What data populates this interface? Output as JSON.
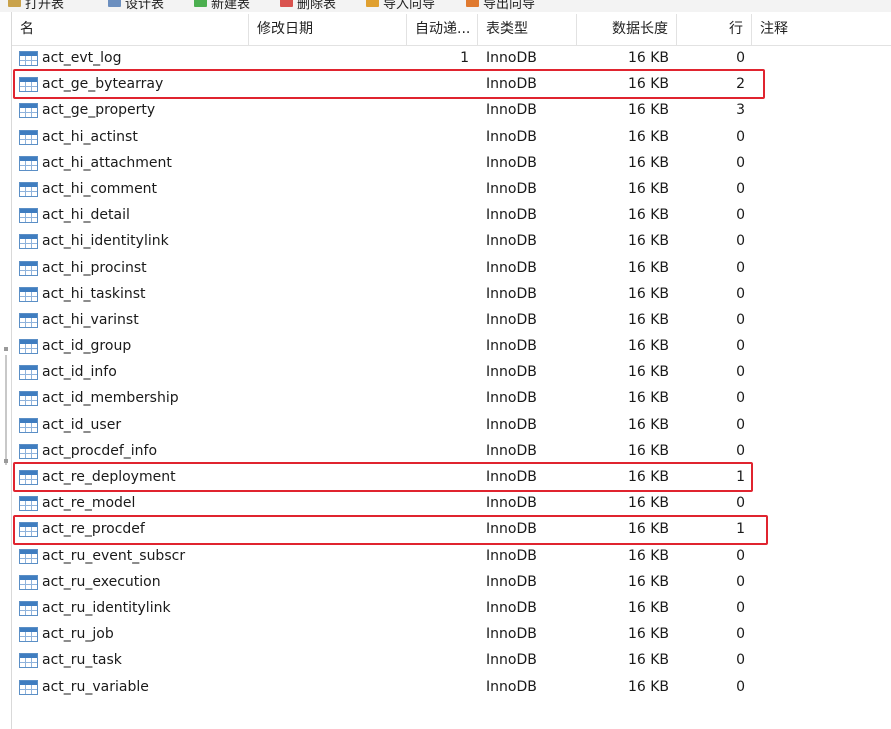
{
  "toolbar": {
    "items": [
      {
        "label": "打开表",
        "icon": "open-table-icon",
        "color": "#c9a24b"
      },
      {
        "label": "设计表",
        "icon": "design-table-icon",
        "color": "#6c8fbf"
      },
      {
        "label": "新建表",
        "icon": "new-table-icon",
        "color": "#4caf50"
      },
      {
        "label": "删除表",
        "icon": "delete-table-icon",
        "color": "#d9534f"
      },
      {
        "label": "导入向导",
        "icon": "import-wizard-icon",
        "color": "#e0a030"
      },
      {
        "label": "导出向导",
        "icon": "export-wizard-icon",
        "color": "#e07a30"
      }
    ]
  },
  "table": {
    "columns": [
      "名",
      "修改日期",
      "自动递...",
      "表类型",
      "数据长度",
      "行",
      "注释"
    ],
    "rows": [
      {
        "name": "act_evt_log",
        "modified": "",
        "auto_inc": "1",
        "engine": "InnoDB",
        "data_length": "16 KB",
        "rows": "0",
        "comment": "",
        "highlighted": false
      },
      {
        "name": "act_ge_bytearray",
        "modified": "",
        "auto_inc": "",
        "engine": "InnoDB",
        "data_length": "16 KB",
        "rows": "2",
        "comment": "",
        "highlighted": true
      },
      {
        "name": "act_ge_property",
        "modified": "",
        "auto_inc": "",
        "engine": "InnoDB",
        "data_length": "16 KB",
        "rows": "3",
        "comment": "",
        "highlighted": false
      },
      {
        "name": "act_hi_actinst",
        "modified": "",
        "auto_inc": "",
        "engine": "InnoDB",
        "data_length": "16 KB",
        "rows": "0",
        "comment": "",
        "highlighted": false
      },
      {
        "name": "act_hi_attachment",
        "modified": "",
        "auto_inc": "",
        "engine": "InnoDB",
        "data_length": "16 KB",
        "rows": "0",
        "comment": "",
        "highlighted": false
      },
      {
        "name": "act_hi_comment",
        "modified": "",
        "auto_inc": "",
        "engine": "InnoDB",
        "data_length": "16 KB",
        "rows": "0",
        "comment": "",
        "highlighted": false
      },
      {
        "name": "act_hi_detail",
        "modified": "",
        "auto_inc": "",
        "engine": "InnoDB",
        "data_length": "16 KB",
        "rows": "0",
        "comment": "",
        "highlighted": false
      },
      {
        "name": "act_hi_identitylink",
        "modified": "",
        "auto_inc": "",
        "engine": "InnoDB",
        "data_length": "16 KB",
        "rows": "0",
        "comment": "",
        "highlighted": false
      },
      {
        "name": "act_hi_procinst",
        "modified": "",
        "auto_inc": "",
        "engine": "InnoDB",
        "data_length": "16 KB",
        "rows": "0",
        "comment": "",
        "highlighted": false
      },
      {
        "name": "act_hi_taskinst",
        "modified": "",
        "auto_inc": "",
        "engine": "InnoDB",
        "data_length": "16 KB",
        "rows": "0",
        "comment": "",
        "highlighted": false
      },
      {
        "name": "act_hi_varinst",
        "modified": "",
        "auto_inc": "",
        "engine": "InnoDB",
        "data_length": "16 KB",
        "rows": "0",
        "comment": "",
        "highlighted": false
      },
      {
        "name": "act_id_group",
        "modified": "",
        "auto_inc": "",
        "engine": "InnoDB",
        "data_length": "16 KB",
        "rows": "0",
        "comment": "",
        "highlighted": false
      },
      {
        "name": "act_id_info",
        "modified": "",
        "auto_inc": "",
        "engine": "InnoDB",
        "data_length": "16 KB",
        "rows": "0",
        "comment": "",
        "highlighted": false
      },
      {
        "name": "act_id_membership",
        "modified": "",
        "auto_inc": "",
        "engine": "InnoDB",
        "data_length": "16 KB",
        "rows": "0",
        "comment": "",
        "highlighted": false
      },
      {
        "name": "act_id_user",
        "modified": "",
        "auto_inc": "",
        "engine": "InnoDB",
        "data_length": "16 KB",
        "rows": "0",
        "comment": "",
        "highlighted": false
      },
      {
        "name": "act_procdef_info",
        "modified": "",
        "auto_inc": "",
        "engine": "InnoDB",
        "data_length": "16 KB",
        "rows": "0",
        "comment": "",
        "highlighted": false
      },
      {
        "name": "act_re_deployment",
        "modified": "",
        "auto_inc": "",
        "engine": "InnoDB",
        "data_length": "16 KB",
        "rows": "1",
        "comment": "",
        "highlighted": true
      },
      {
        "name": "act_re_model",
        "modified": "",
        "auto_inc": "",
        "engine": "InnoDB",
        "data_length": "16 KB",
        "rows": "0",
        "comment": "",
        "highlighted": false
      },
      {
        "name": "act_re_procdef",
        "modified": "",
        "auto_inc": "",
        "engine": "InnoDB",
        "data_length": "16 KB",
        "rows": "1",
        "comment": "",
        "highlighted": true
      },
      {
        "name": "act_ru_event_subscr",
        "modified": "",
        "auto_inc": "",
        "engine": "InnoDB",
        "data_length": "16 KB",
        "rows": "0",
        "comment": "",
        "highlighted": false
      },
      {
        "name": "act_ru_execution",
        "modified": "",
        "auto_inc": "",
        "engine": "InnoDB",
        "data_length": "16 KB",
        "rows": "0",
        "comment": "",
        "highlighted": false
      },
      {
        "name": "act_ru_identitylink",
        "modified": "",
        "auto_inc": "",
        "engine": "InnoDB",
        "data_length": "16 KB",
        "rows": "0",
        "comment": "",
        "highlighted": false
      },
      {
        "name": "act_ru_job",
        "modified": "",
        "auto_inc": "",
        "engine": "InnoDB",
        "data_length": "16 KB",
        "rows": "0",
        "comment": "",
        "highlighted": false
      },
      {
        "name": "act_ru_task",
        "modified": "",
        "auto_inc": "",
        "engine": "InnoDB",
        "data_length": "16 KB",
        "rows": "0",
        "comment": "",
        "highlighted": false
      },
      {
        "name": "act_ru_variable",
        "modified": "",
        "auto_inc": "",
        "engine": "InnoDB",
        "data_length": "16 KB",
        "rows": "0",
        "comment": "",
        "highlighted": false
      }
    ]
  },
  "colors": {
    "highlight": "#e0242f",
    "table_icon": "#3f7dc0"
  }
}
